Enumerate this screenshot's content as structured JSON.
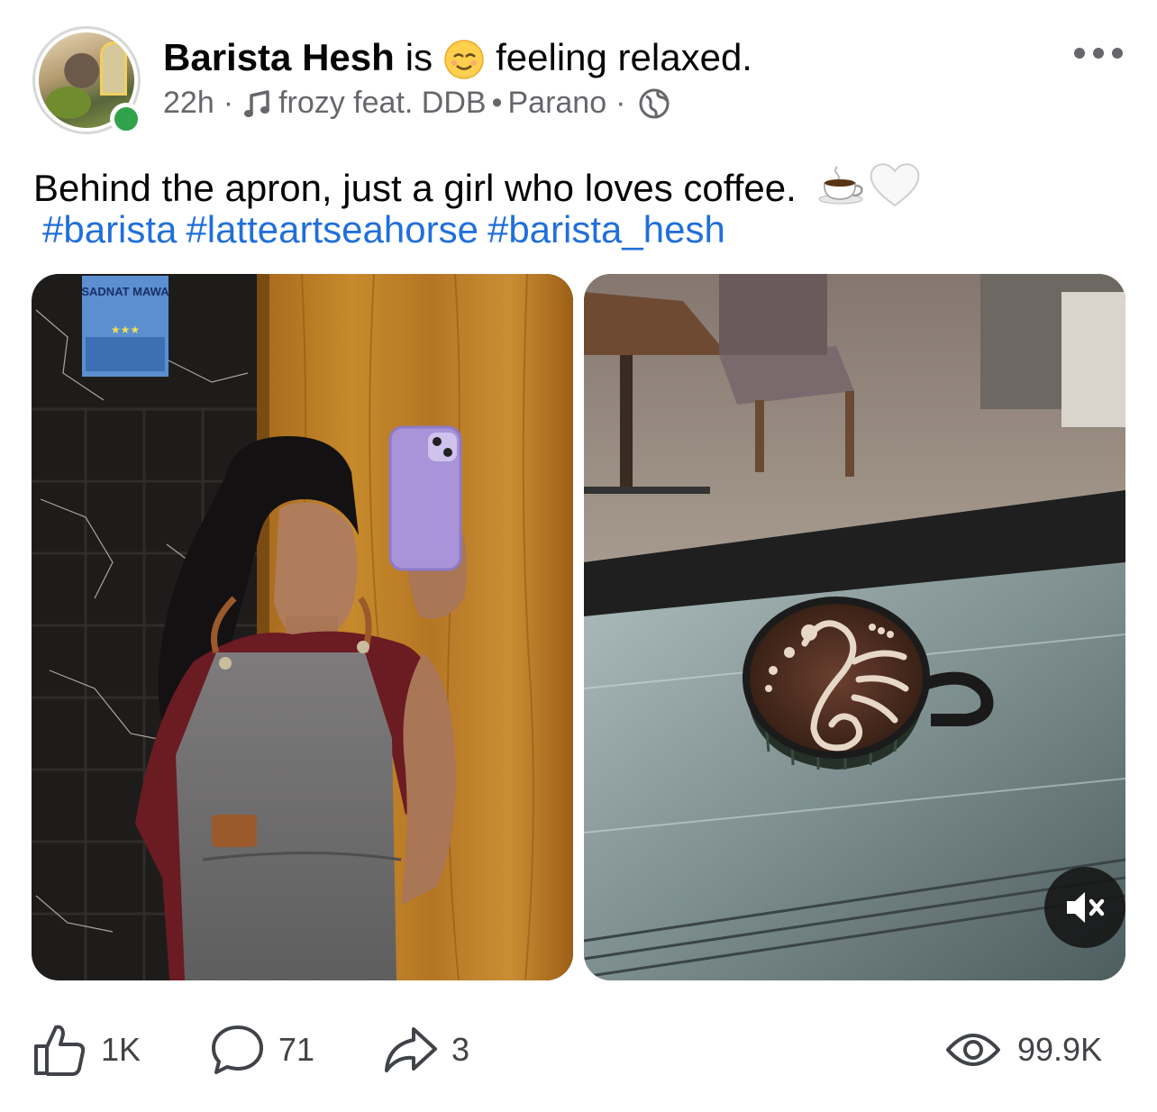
{
  "post": {
    "author": "Barista Hesh",
    "is_word": "is",
    "feeling": "feeling relaxed.",
    "time": "22h",
    "separator": "·",
    "song": "frozy feat. DDB",
    "artist": "Parano",
    "song_separator": "•",
    "caption": "Behind the apron, just a girl who loves coffee.",
    "hashtags": [
      "#barista",
      "#latteartseahorse",
      "#barista_hesh"
    ],
    "images": [
      {
        "icon": "photo-barista-selfie",
        "sign_text": "SADNAT MAWA"
      },
      {
        "icon": "photo-latte-art-seahorse"
      }
    ]
  },
  "stats": {
    "likes": "1K",
    "comments": "71",
    "shares": "3",
    "views": "99.9K"
  },
  "icons": {
    "feeling": "relieved-face-emoji",
    "music": "music-note-icon",
    "privacy": "globe-icon",
    "more": "more-options-icon",
    "caption_emoji_1": "hot-beverage-emoji",
    "caption_emoji_2": "white-heart-emoji",
    "mute": "speaker-muted-icon",
    "like": "thumbs-up-icon",
    "comment": "comment-bubble-icon",
    "share": "share-arrow-icon",
    "views": "eye-icon"
  },
  "colors": {
    "hashtag": "#216fdb",
    "online": "#31a24c",
    "secondary_text": "#65676b"
  }
}
